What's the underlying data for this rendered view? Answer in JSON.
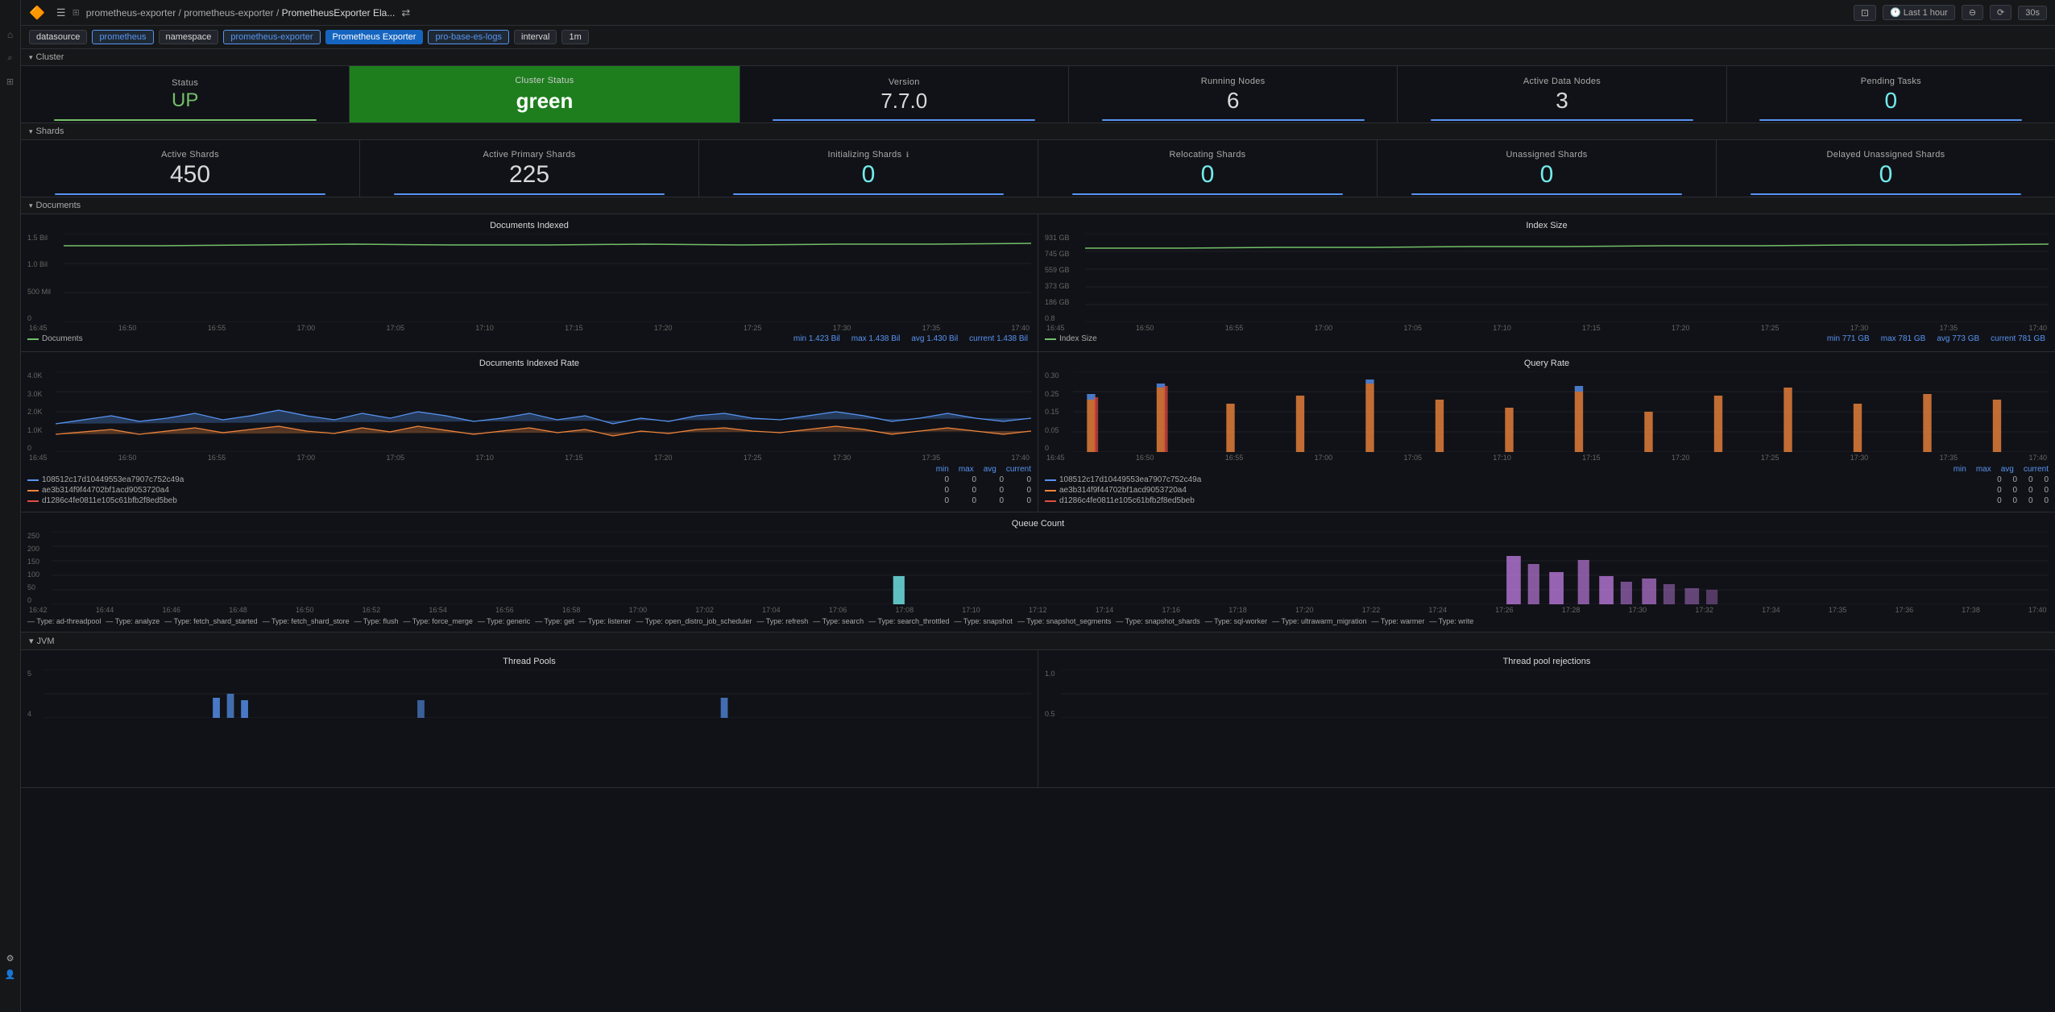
{
  "topbar": {
    "logo": "🔶",
    "breadcrumb1": "prometheus-exporter",
    "breadcrumb2": "prometheus-exporter",
    "breadcrumb3": "PrometheusExporter Ela...",
    "share_icon": "⇄",
    "time_range": "Last 1 hour",
    "refresh": "30s"
  },
  "toolbar": {
    "datasource_label": "datasource",
    "datasource_value": "prometheus",
    "namespace_label": "namespace",
    "namespace_value": "prometheus-exporter",
    "dashboard_label": "Prometheus Exporter",
    "job_label": "pro-base-es-logs",
    "interval_label": "interval",
    "interval_value": "1m"
  },
  "cluster_section": {
    "label": "Cluster",
    "panels": [
      {
        "label": "Status",
        "value": "UP",
        "type": "status"
      },
      {
        "label": "Cluster Status",
        "value": "green",
        "type": "cluster_status"
      },
      {
        "label": "Version",
        "value": "7.7.0",
        "type": "version"
      },
      {
        "label": "Running Nodes",
        "value": "6",
        "type": "nodes"
      },
      {
        "label": "Active Data Nodes",
        "value": "3",
        "type": "nodes"
      },
      {
        "label": "Pending Tasks",
        "value": "0",
        "type": "tasks"
      }
    ]
  },
  "shards_section": {
    "label": "Shards",
    "panels": [
      {
        "label": "Active Shards",
        "value": "450",
        "type": "shards"
      },
      {
        "label": "Active Primary Shards",
        "value": "225",
        "type": "shards"
      },
      {
        "label": "Initializing Shards",
        "value": "0",
        "type": "shards"
      },
      {
        "label": "Relocating Shards",
        "value": "0",
        "type": "shards"
      },
      {
        "label": "Unassigned Shards",
        "value": "0",
        "type": "shards"
      },
      {
        "label": "Delayed Unassigned Shards",
        "value": "0",
        "type": "shards"
      }
    ]
  },
  "documents_section": {
    "label": "Documents",
    "charts": {
      "docs_indexed": {
        "title": "Documents Indexed",
        "legend": "Documents",
        "y_labels": [
          "1.5 Bil",
          "1.0 Bil",
          "500 Mil",
          "0"
        ],
        "x_labels": [
          "16:45",
          "16:50",
          "16:55",
          "17:00",
          "17:05",
          "17:10",
          "17:15",
          "17:20",
          "17:25",
          "17:30",
          "17:35",
          "17:40"
        ],
        "stats": {
          "min_label": "min",
          "max_label": "max",
          "avg_label": "avg",
          "current_label": "current",
          "min": "1.423 Bil",
          "max": "1.438 Bil",
          "avg": "1.430 Bil",
          "current": "1.438 Bil"
        }
      },
      "index_size": {
        "title": "Index Size",
        "legend": "Index Size",
        "y_labels": [
          "931 GB",
          "745 GB",
          "559 GB",
          "373 GB",
          "186 GB",
          "0.8"
        ],
        "x_labels": [
          "16:45",
          "16:50",
          "16:55",
          "17:00",
          "17:05",
          "17:10",
          "17:15",
          "17:20",
          "17:25",
          "17:30",
          "17:35",
          "17:40"
        ],
        "stats": {
          "min": "771 GB",
          "max": "781 GB",
          "avg": "773 GB",
          "current": "781 GB"
        }
      },
      "docs_rate": {
        "title": "Documents Indexed Rate",
        "y_labels": [
          "4.0K",
          "3.0K",
          "2.0K",
          "1.0K",
          "0"
        ],
        "x_labels": [
          "16:45",
          "16:50",
          "16:55",
          "17:00",
          "17:05",
          "17:10",
          "17:15",
          "17:20",
          "17:25",
          "17:30",
          "17:35",
          "17:40"
        ],
        "series": [
          {
            "id": "108512c17d10449553ea7907c752c49a",
            "color": "#5794f2",
            "min": "0",
            "max": "0",
            "avg": "0",
            "current": "0"
          },
          {
            "id": "ae3b314f9f44702bf1acd9053720a4",
            "color": "#ef843c",
            "min": "0",
            "max": "0",
            "avg": "0",
            "current": "0"
          },
          {
            "id": "d1286c4fe0811e105c61bfb2f8ed5beb",
            "color": "#e24d42",
            "min": "0",
            "max": "0",
            "avg": "0",
            "current": "0"
          }
        ]
      },
      "query_rate": {
        "title": "Query Rate",
        "y_labels": [
          "0.30",
          "0.25",
          "0.15",
          "0.05",
          "0"
        ],
        "x_labels": [
          "16:45",
          "16:50",
          "16:55",
          "17:00",
          "17:05",
          "17:10",
          "17:15",
          "17:20",
          "17:25",
          "17:30",
          "17:35",
          "17:40"
        ],
        "series": [
          {
            "id": "108512c17d10449553ea7907c752c49a",
            "color": "#5794f2",
            "min": "0",
            "max": "0",
            "avg": "0",
            "current": "0"
          },
          {
            "id": "ae3b314f9f44702bf1acd9053720a4",
            "color": "#ef843c",
            "min": "0",
            "max": "0",
            "avg": "0",
            "current": "0"
          },
          {
            "id": "d1286c4fe0811e105c61bfb2f8ed5beb",
            "color": "#e24d42",
            "min": "0",
            "max": "0",
            "avg": "0",
            "current": "0"
          }
        ]
      }
    }
  },
  "queue_section": {
    "title": "Queue Count",
    "y_labels": [
      "250",
      "200",
      "150",
      "100",
      "50",
      "0"
    ],
    "x_labels": [
      "16:42",
      "16:44",
      "16:46",
      "16:48",
      "16:50",
      "16:52",
      "16:54",
      "16:56",
      "16:58",
      "17:00",
      "17:02",
      "17:04",
      "17:06",
      "17:08",
      "17:10",
      "17:12",
      "17:14",
      "17:16",
      "17:18",
      "17:20",
      "17:22",
      "17:24",
      "17:26",
      "17:28",
      "17:30",
      "17:32",
      "17:34",
      "17:35",
      "17:36",
      "17:38",
      "17:40"
    ],
    "types": [
      "Type: ad-threadpool",
      "Type: analyze",
      "Type: fetch_shard_started",
      "Type: fetch_shard_store",
      "Type: flush",
      "Type: force_merge",
      "Type: generic",
      "Type: get",
      "Type: listener",
      "Type: open_distro_job_scheduler",
      "Type: refresh",
      "Type: search",
      "Type: search_throttled",
      "Type: snapshot",
      "Type: snapshot_segments",
      "Type: snapshot_shards",
      "Type: sql-worker",
      "Type: ultrawarm_migration",
      "Type: warmer",
      "Type: write"
    ]
  },
  "jvm_section": {
    "label": "JVM",
    "charts": {
      "thread_pools": {
        "title": "Thread Pools",
        "y_labels": [
          "5",
          "4"
        ]
      },
      "thread_pool_rejections": {
        "title": "Thread pool rejections",
        "y_labels": [
          "1.0",
          "0.5"
        ]
      }
    }
  }
}
